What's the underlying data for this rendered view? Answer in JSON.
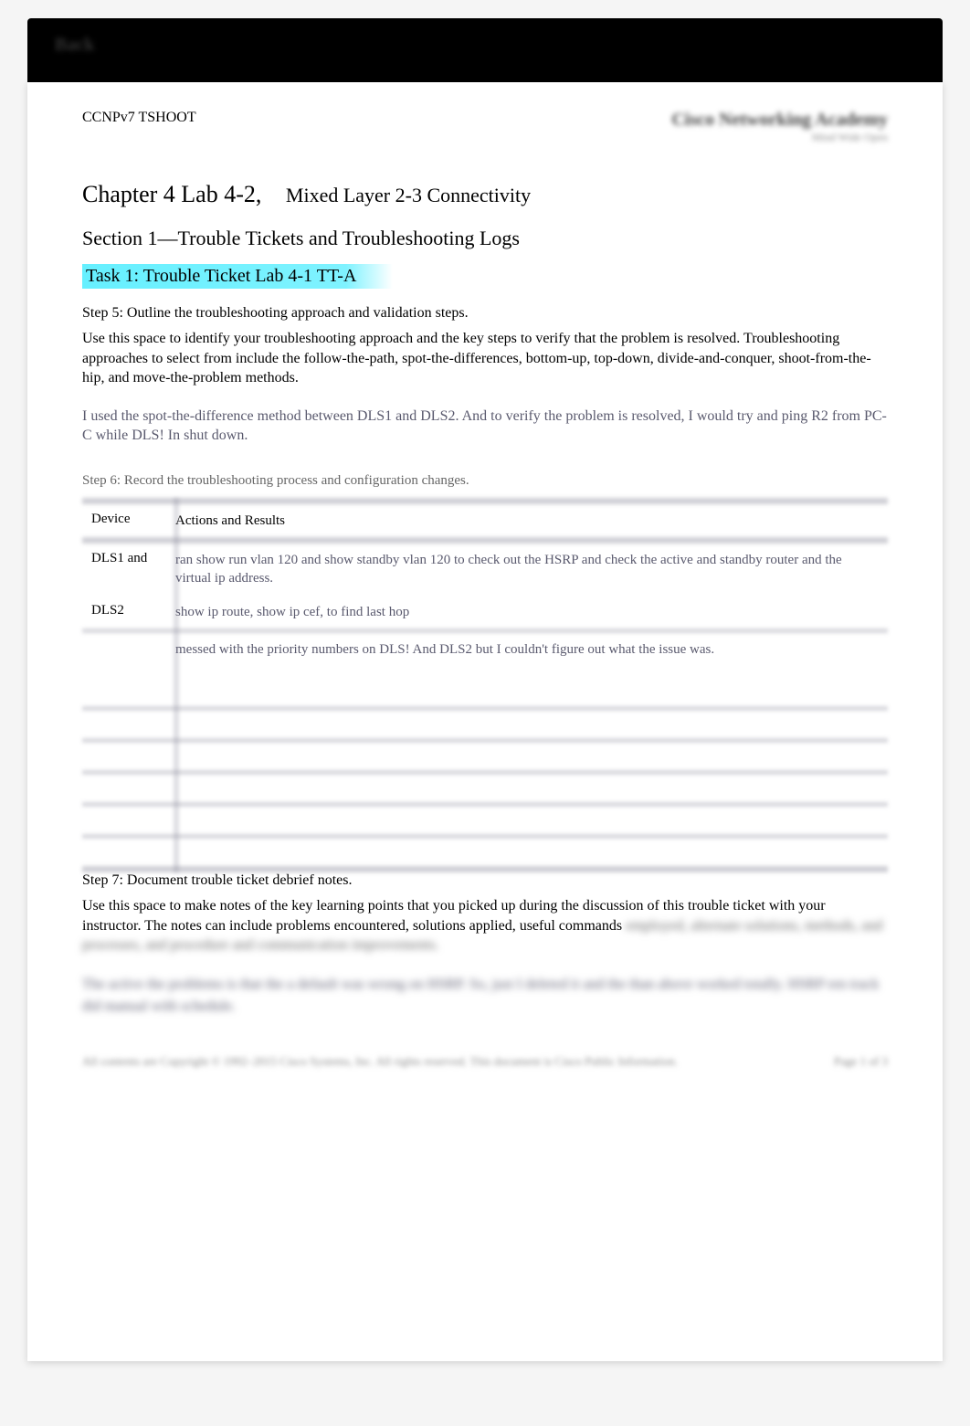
{
  "topbar": {
    "label": "Back"
  },
  "header": {
    "course": "CCNPv7 TSHOOT",
    "brand_title": "Cisco Networking Academy",
    "brand_subtitle": "Mind Wide Open"
  },
  "chapter": {
    "lab": "Chapter 4 Lab 4-2,",
    "subtitle": "Mixed Layer 2-3 Connectivity"
  },
  "section": "Section 1—Trouble Tickets and Troubleshooting Logs",
  "task": "Task 1:   Trouble Ticket Lab 4-1 TT-A",
  "step5": {
    "heading": "Step 5: Outline the troubleshooting approach and validation steps.",
    "body": "Use this space to identify your troubleshooting approach and the key steps to verify that the problem is resolved. Troubleshooting approaches to select from include the follow-the-path, spot-the-differences, bottom-up, top-down, divide-and-conquer, shoot-from-the-hip, and move-the-problem methods.",
    "answer": "I used the spot-the-difference method between DLS1 and DLS2. And to verify the problem is resolved, I would try and ping R2 from PC-C while DLS! In shut down."
  },
  "step6": {
    "heading": "Step 6: Record the troubleshooting process and configuration changes.",
    "columns": {
      "device": "Device",
      "actions": "Actions and Results"
    },
    "rows": [
      {
        "device": "DLS1 and",
        "actions": "ran show run vlan 120 and show standby vlan 120 to check out the HSRP and check the active and standby router and the virtual ip address."
      },
      {
        "device": "DLS2",
        "actions": "show ip route, show ip cef, to find last hop"
      },
      {
        "device": "",
        "actions": "messed with the priority numbers on DLS! And DLS2 but I couldn't figure out what the issue was."
      },
      {
        "device": "",
        "actions": ""
      },
      {
        "device": "",
        "actions": ""
      },
      {
        "device": "",
        "actions": ""
      },
      {
        "device": "",
        "actions": ""
      },
      {
        "device": "",
        "actions": ""
      }
    ]
  },
  "step7": {
    "heading": "Step 7: Document trouble ticket debrief notes.",
    "body_visible": "Use this space to make notes of the key learning points that you picked up during the discussion of this trouble ticket with your instructor. The notes can include problems encountered, solutions applied, useful commands",
    "body_blurred": "employed, alternate solutions, methods, and processes, and procedure and communication improvements.",
    "answer_blurred": "The active the problems is that the a default was wrong on HSRP. So, just I deleted it and the\nthan above worked totally. HSRP ren track did manual with schedule."
  },
  "footer": {
    "left": "All contents are Copyright © 1992–2015 Cisco Systems, Inc. All rights reserved. This document is Cisco Public Information.",
    "right": "Page 1 of 3"
  }
}
